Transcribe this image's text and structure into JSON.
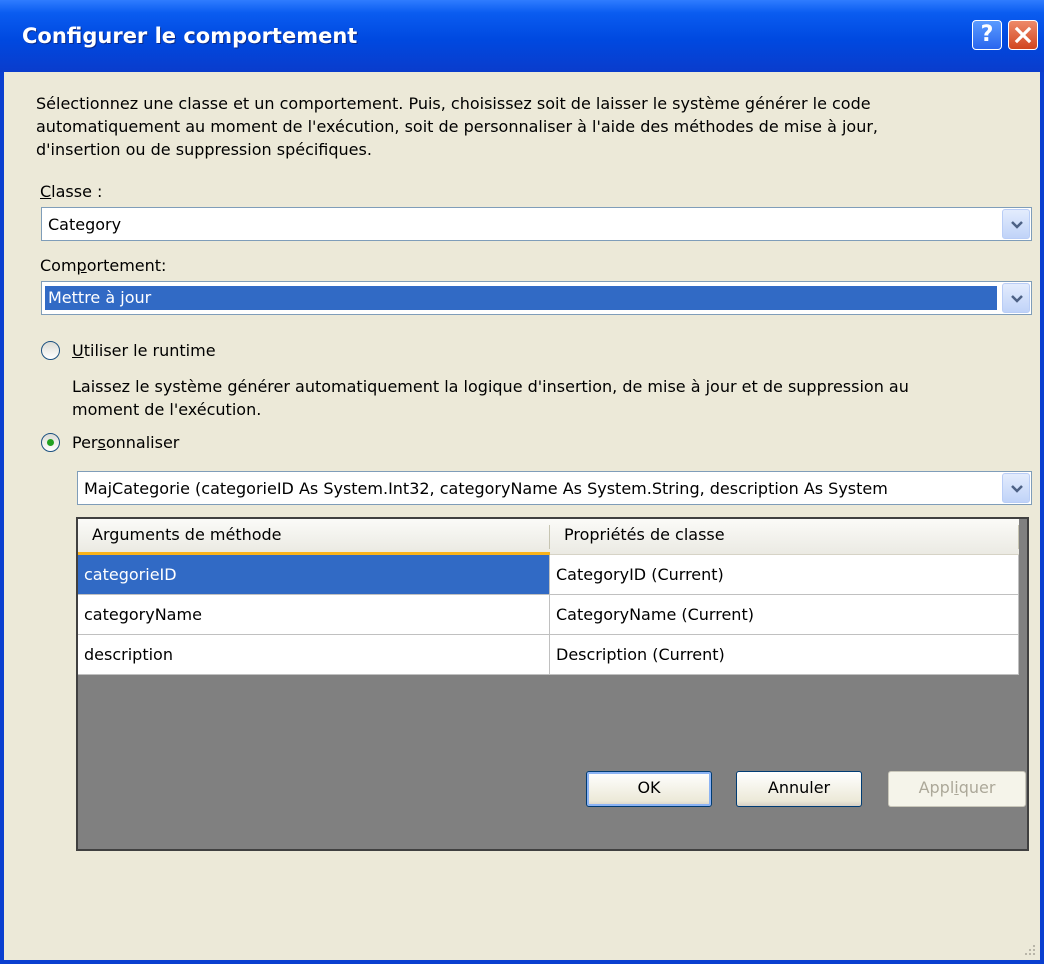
{
  "window": {
    "title": "Configurer le comportement"
  },
  "description": [
    "Sélectionnez une classe et un comportement. Puis, choisissez soit de laisser le système générer le code",
    "automatiquement au moment de l'exécution, soit de personnaliser à l'aide des méthodes de mise à jour,",
    "d'insertion ou de suppression spécifiques."
  ],
  "classe": {
    "label_mnemonic": "C",
    "label_rest": "lasse :",
    "value": "Category"
  },
  "comportement": {
    "label_before": "Com",
    "label_mnemonic": "p",
    "label_after": "ortement:",
    "value": "Mettre à jour"
  },
  "runtime_option": {
    "label_mnemonic": "U",
    "label_rest": "tiliser le runtime",
    "selected": false,
    "help": [
      "Laissez le système générer automatiquement la logique d'insertion, de mise à jour et de suppression au",
      "moment de l'exécution."
    ]
  },
  "custom_option": {
    "label_before": "Per",
    "label_mnemonic": "s",
    "label_after": "onnaliser",
    "selected": true
  },
  "method": {
    "value": "MajCategorie (categorieID As System.Int32, categoryName As System.String, description As System"
  },
  "table": {
    "headers": [
      "Arguments de méthode",
      "Propriétés de classe"
    ],
    "rows": [
      {
        "arg": "categorieID",
        "prop": "CategoryID (Current)",
        "selected": true
      },
      {
        "arg": "categoryName",
        "prop": "CategoryName (Current)",
        "selected": false
      },
      {
        "arg": "description",
        "prop": "Description (Current)",
        "selected": false
      }
    ]
  },
  "buttons": {
    "ok": "OK",
    "cancel": "Annuler",
    "apply_before": "Appl",
    "apply_mnemonic": "i",
    "apply_after": "quer"
  },
  "colors": {
    "selection": "#316ac5",
    "title_bar": "#0a5cf0",
    "dialog_bg": "#ece9d8",
    "header_accent": "#f9b21b"
  }
}
